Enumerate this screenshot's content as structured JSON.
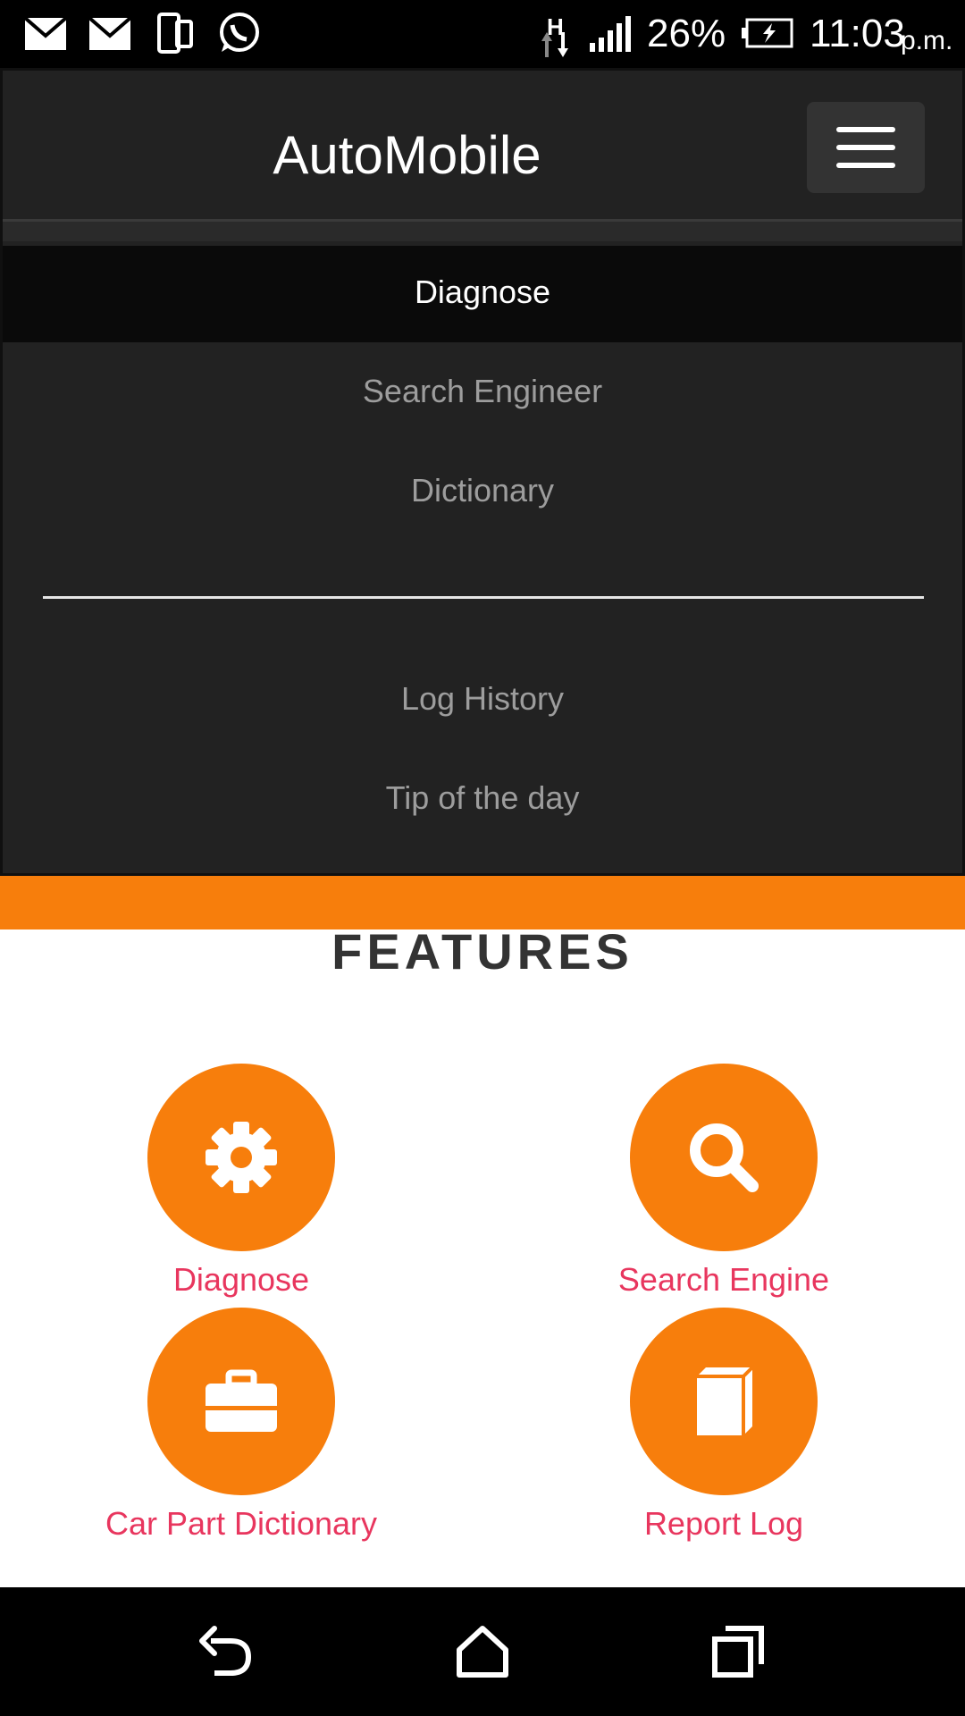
{
  "status_bar": {
    "battery": "26%",
    "time": "11:03",
    "ampm": "p.m.",
    "network": "H",
    "icons": [
      "mail-icon",
      "mail-icon",
      "dual-phone-icon",
      "whatsapp-icon",
      "network-data-icon",
      "signal-icon",
      "battery-charging-icon"
    ]
  },
  "navbar": {
    "brand": "AutoMobile",
    "toggle_icon": "hamburger-menu-icon",
    "items": [
      {
        "label": "Diagnose",
        "active": true
      },
      {
        "label": "Search Engineer"
      },
      {
        "label": "Dictionary"
      },
      {
        "label": "Log History"
      },
      {
        "label": "Tip of the day"
      }
    ]
  },
  "features": {
    "title": "FEATURES",
    "items": [
      {
        "label": "Diagnose",
        "icon": "gear-icon"
      },
      {
        "label": "Search Engine",
        "icon": "search-icon"
      },
      {
        "label": "Car Part Dictionary",
        "icon": "briefcase-icon"
      },
      {
        "label": "Report Log",
        "icon": "book-icon"
      }
    ]
  },
  "colors": {
    "accent": "#f77e0c",
    "feature_label": "#e8365e",
    "navbar_bg": "#222222"
  },
  "system_nav": [
    "back-icon",
    "home-icon",
    "recents-icon"
  ]
}
